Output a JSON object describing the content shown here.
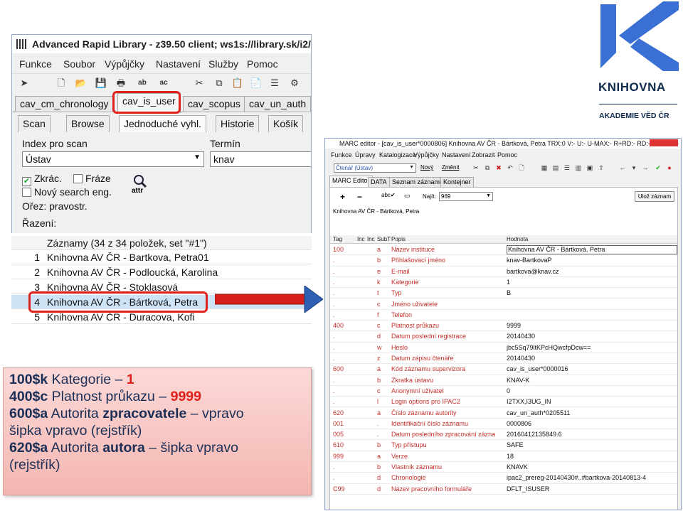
{
  "left_window": {
    "title": "Advanced Rapid Library - z39.50 client; ws1s://library.sk/i2/i2.ws...",
    "menu": [
      "Funkce",
      "Soubor",
      "Výpůjčky",
      "Nastavení",
      "Služby",
      "Pomoc"
    ],
    "tabs_top": [
      "cav_cm_chronology",
      "cav_is_user",
      "cav_scopus",
      "cav_un_auth"
    ],
    "tabs_second": [
      "Scan",
      "Browse",
      "Jednoduché vyhl.",
      "Historie",
      "Košík"
    ],
    "index_label": "Index pro scan",
    "index_value": "Ústav",
    "term_label": "Termín",
    "term_value": "knav",
    "option_zkrac": "Zkrác.",
    "option_fraze": "Fráze",
    "option_new_search": "Nový search eng.",
    "attr_label": "attr",
    "orez_label": "Ořez: pravostr.",
    "razeni_label": "Řazení:",
    "records_header": "Záznamy (34 z 34 položek, set \"#1\")",
    "records": [
      {
        "num": "1",
        "text": "Knihovna AV ČR - Bartkova, Petra01"
      },
      {
        "num": "2",
        "text": "Knihovna AV ČR - Podloucká, Karolina"
      },
      {
        "num": "3",
        "text": "Knihovna AV ČR - Stoklasová"
      },
      {
        "num": "4",
        "text": "Knihovna AV ČR - Bártková, Petra"
      },
      {
        "num": "5",
        "text": "Knihovna AV ČR - Duracova, Kofi"
      }
    ]
  },
  "right_window": {
    "title": "MARC editor - [cav_is_user*0000806] Knihovna AV ČR - Bártková, Petra TRX:0 V:- U:- U-MAX:- R+RD:- RD:- Z:- P:- L:- K:-",
    "menu": [
      "Funkce",
      "Úpravy",
      "Katalogizace",
      "Výpůjčky",
      "Nastavení",
      "Zobrazit",
      "Pomoc"
    ],
    "reader_combo": "Čtenář (Ústav)",
    "btn_new": "Nový",
    "btn_change": "Změnit",
    "tabs": [
      "MARC Editor",
      "DATA",
      "Seznam záznamů",
      "Kontejner"
    ],
    "find_label": "Najít:",
    "find_value": "969",
    "save_button": "Ulož záznam",
    "record_name": "Knihovna AV ČR - Bártková, Petra",
    "columns": [
      "Tag",
      "Inc",
      "Inc",
      "SubT",
      "Popis",
      "Hodnota"
    ],
    "rows": [
      {
        "tag": "100",
        "sub": "a",
        "desc": "Název instituce",
        "val": "Knihovna AV ČR - Bártková, Petra",
        "sel": true
      },
      {
        "tag": ".",
        "sub": "b",
        "desc": "Přihlašovací jméno",
        "val": "knav-BartkovaP"
      },
      {
        "tag": ".",
        "sub": "e",
        "desc": "E-mail",
        "val": "bartkova@knav.cz"
      },
      {
        "tag": ".",
        "sub": "k",
        "desc": "Kategorie",
        "val": "1"
      },
      {
        "tag": ".",
        "sub": "t",
        "desc": "Typ",
        "val": "B"
      },
      {
        "tag": ".",
        "sub": "c",
        "desc": "Jméno uživatele",
        "val": ""
      },
      {
        "tag": ".",
        "sub": "f",
        "desc": "Telefon",
        "val": ""
      },
      {
        "tag": "400",
        "sub": "c",
        "desc": "Platnost průkazu",
        "val": "9999"
      },
      {
        "tag": ".",
        "sub": "d",
        "desc": "Datum poslední registrace",
        "val": "20140430"
      },
      {
        "tag": ".",
        "sub": "w",
        "desc": "Heslo",
        "val": "jbc5Sq79ltKPcHQwcfpDcw=="
      },
      {
        "tag": ".",
        "sub": "z",
        "desc": "Datum zápisu čtenáře",
        "val": "20140430"
      },
      {
        "tag": "600",
        "sub": "a",
        "desc": "Kód záznamu supervizora",
        "val": "cav_is_user*0000016"
      },
      {
        "tag": ".",
        "sub": "b",
        "desc": "Zkratka ústavu",
        "val": "KNAV-K"
      },
      {
        "tag": ".",
        "sub": "c",
        "desc": "Anonymní uživatel",
        "val": "0"
      },
      {
        "tag": ".",
        "sub": "l",
        "desc": "Login options pro IPAC2",
        "val": "I2TXX,I3UG_IN"
      },
      {
        "tag": "620",
        "sub": "a",
        "desc": "Číslo záznamu autority",
        "val": "cav_un_auth*0205511"
      },
      {
        "tag": "001",
        "sub": ".",
        "desc": "Identifikační číslo záznamu",
        "val": "0000806"
      },
      {
        "tag": "005",
        "sub": ".",
        "desc": "Datum posledního zpracování zázna",
        "val": "20160412135849.6"
      },
      {
        "tag": "610",
        "sub": "b",
        "desc": "Typ přístupu",
        "val": "SAFE"
      },
      {
        "tag": "999",
        "sub": "a",
        "desc": "Verze",
        "val": "18"
      },
      {
        "tag": ".",
        "sub": "b",
        "desc": "Vlastník záznamu",
        "val": "KNAVK"
      },
      {
        "tag": ".",
        "sub": "d",
        "desc": "Chronologie",
        "val": "ipac2_prereg-20140430#..#bartkova-20140813-4"
      },
      {
        "tag": "C99",
        "sub": "d",
        "desc": "Název pracovního formuláře",
        "val": "DFLT_ISUSER"
      }
    ]
  },
  "note": {
    "line1_code": "100$k",
    "line1_text": " Kategorie – ",
    "line1_num": "1",
    "line2_code": "400$c",
    "line2_text": " Platnost průkazu – ",
    "line2_num": "9999",
    "line3_code": "600$a",
    "line3_text": " Autorita ",
    "line3_bold": "zpracovatele",
    "line3_tail": " – vpravo",
    "line4": "šipka vpravo (rejstřík)",
    "line5_code": "620$a",
    "line5_text": " Autorita ",
    "line5_bold": "autora",
    "line5_tail": " – šipka vpravo",
    "line6": "(rejstřík)"
  },
  "logo": {
    "name": "KNIHOVNA",
    "sub": "AKADEMIE VĚD ČR",
    "color": "#3a6fd3"
  },
  "colors": {
    "annotation_red": "#e0201b",
    "note_bg": "#f8c8c4",
    "marc_red": "#c4302b"
  }
}
